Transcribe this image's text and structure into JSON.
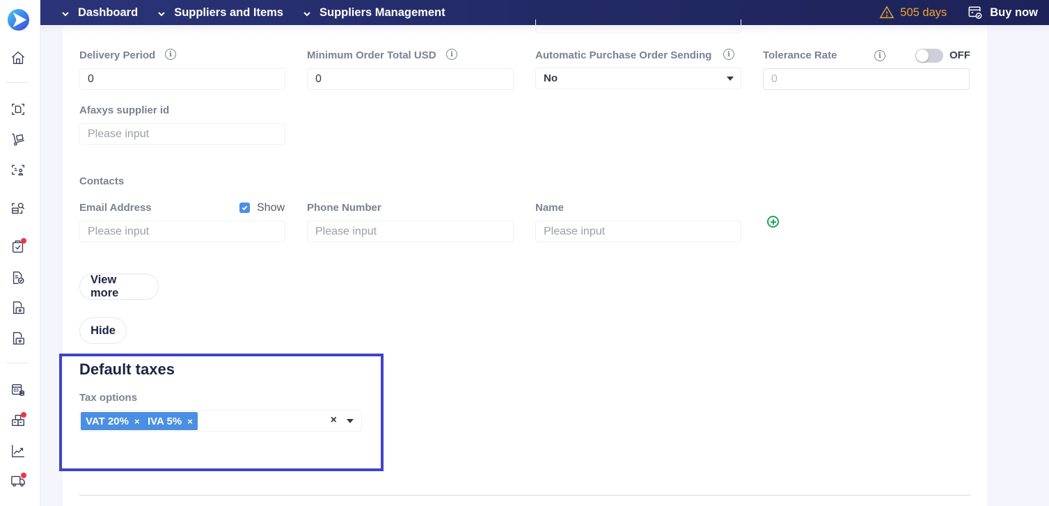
{
  "topbar": {
    "breadcrumbs": [
      {
        "label": "Dashboard"
      },
      {
        "label": "Suppliers and Items"
      },
      {
        "label": "Suppliers Management"
      }
    ],
    "trial_text": "505 days",
    "buy_label": "Buy now",
    "trial_color": "#f0a42a"
  },
  "sidebar": {
    "items": [
      {
        "icon": "home-icon"
      },
      {
        "icon": "scan-document-icon"
      },
      {
        "icon": "cart-trolley-icon"
      },
      {
        "icon": "supplier-profile-icon"
      },
      {
        "icon": "delivery-search-icon"
      },
      {
        "icon": "clipboard-check-icon",
        "badge": true
      },
      {
        "icon": "document-check-icon"
      },
      {
        "icon": "invoice-payment-icon"
      },
      {
        "icon": "invoice-payment-alt-icon"
      },
      {
        "icon": "calendar-database-icon"
      },
      {
        "icon": "inventory-boxes-icon",
        "badge": true
      },
      {
        "icon": "analytics-chart-icon"
      },
      {
        "icon": "truck-icon",
        "badge": true
      }
    ]
  },
  "form": {
    "delivery_period": {
      "label": "Delivery Period",
      "value": "0"
    },
    "minimum_order": {
      "label": "Minimum Order Total USD",
      "value": "0"
    },
    "auto_po": {
      "label": "Automatic Purchase Order Sending",
      "value": "No"
    },
    "tolerance": {
      "label": "Tolerance Rate",
      "toggle_state": "OFF",
      "placeholder": "0"
    },
    "afaxys_id": {
      "label": "Afaxys supplier id",
      "placeholder": "Please input"
    },
    "contacts": {
      "title": "Contacts",
      "email": {
        "label": "Email Address",
        "placeholder": "Please input",
        "show_label": "Show",
        "show_checked": true
      },
      "phone": {
        "label": "Phone Number",
        "placeholder": "Please input"
      },
      "name": {
        "label": "Name",
        "placeholder": "Please input"
      }
    },
    "view_more_label": "View more",
    "hide_label": "Hide"
  },
  "default_taxes": {
    "title": "Default taxes",
    "tax_options_label": "Tax options",
    "selected": [
      {
        "label": "VAT 20%"
      },
      {
        "label": "IVA 5%"
      }
    ],
    "tag_color": "#4b8fe2",
    "highlight_color": "#3f44c8"
  }
}
